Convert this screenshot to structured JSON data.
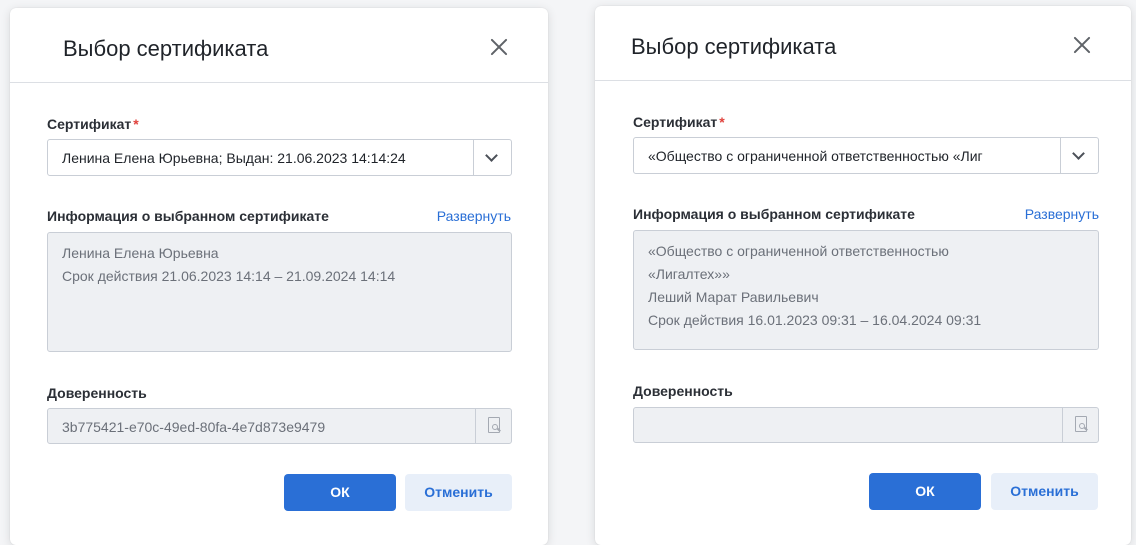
{
  "dialogs": [
    {
      "title": "Выбор сертификата",
      "certificate_label": "Сертификат",
      "required_mark": "*",
      "certificate_value": "Ленина Елена Юрьевна; Выдан: 21.06.2023 14:14:24",
      "info_label": "Информация о выбранном сертификате",
      "expand_link": "Развернуть",
      "info_lines": [
        "Ленина Елена Юрьевна",
        "Срок действия 21.06.2023 14:14 – 21.09.2024 14:14"
      ],
      "poa_label": "Доверенность",
      "poa_value": "3b775421-e70c-49ed-80fa-4e7d873e9479",
      "ok_label": "ОК",
      "cancel_label": "Отменить"
    },
    {
      "title": "Выбор сертификата",
      "certificate_label": "Сертификат",
      "required_mark": "*",
      "certificate_value": "«Общество с ограниченной ответственностью «Лиг",
      "info_label": "Информация о выбранном сертификате",
      "expand_link": "Развернуть",
      "info_lines": [
        "«Общество с ограниченной ответственностью",
        "«Лигалтех»»",
        "Леший Марат Равильевич",
        "Срок действия 16.01.2023 09:31 – 16.04.2024 09:31"
      ],
      "poa_label": "Доверенность",
      "poa_value": "",
      "ok_label": "ОК",
      "cancel_label": "Отменить"
    }
  ],
  "icons": {
    "close": "close-icon",
    "dropdown": "chevron-down-icon",
    "document_search": "document-search-icon"
  },
  "colors": {
    "primary": "#2a6fd6",
    "required": "#e0423c",
    "readonly_bg": "#eef0f3"
  }
}
